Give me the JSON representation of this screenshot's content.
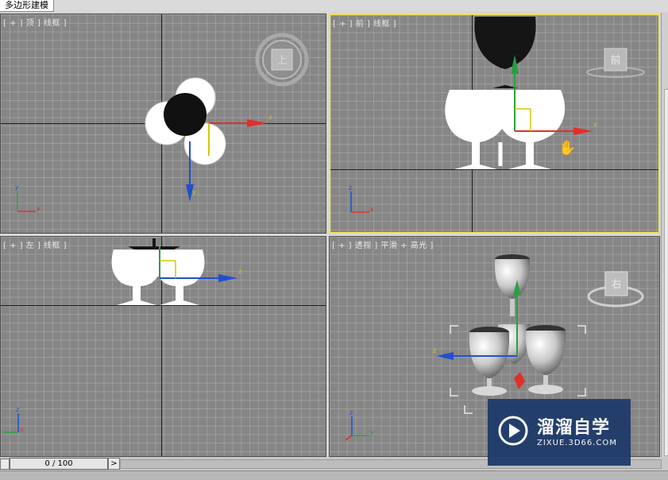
{
  "tab": {
    "label": "多边形建模"
  },
  "viewports": {
    "top": {
      "label": "[ + ] 顶 ] 线框 ]",
      "viewcube_face": "上"
    },
    "front": {
      "label": "[ + ] 前 ] 线框 ]",
      "viewcube_face": "前"
    },
    "left": {
      "label": "[ + ] 左 ] 线框 ]"
    },
    "perspective": {
      "label": "[ + ] 透视 ] 平滑 + 高光 ]",
      "viewcube_face": "右"
    }
  },
  "axes": {
    "x": "x",
    "y": "y",
    "z": "z"
  },
  "timeline": {
    "frame": "0 / 100",
    "prev": "<",
    "next": ">"
  },
  "watermark": {
    "title": "溜溜自学",
    "subtitle": "ZIXUE.3D66.COM"
  },
  "colors": {
    "active_border": "#f2e15a",
    "viewport_bg": "#868686",
    "x_axis": "#e0302a",
    "y_axis": "#2aa040",
    "z_axis": "#2050d0"
  }
}
